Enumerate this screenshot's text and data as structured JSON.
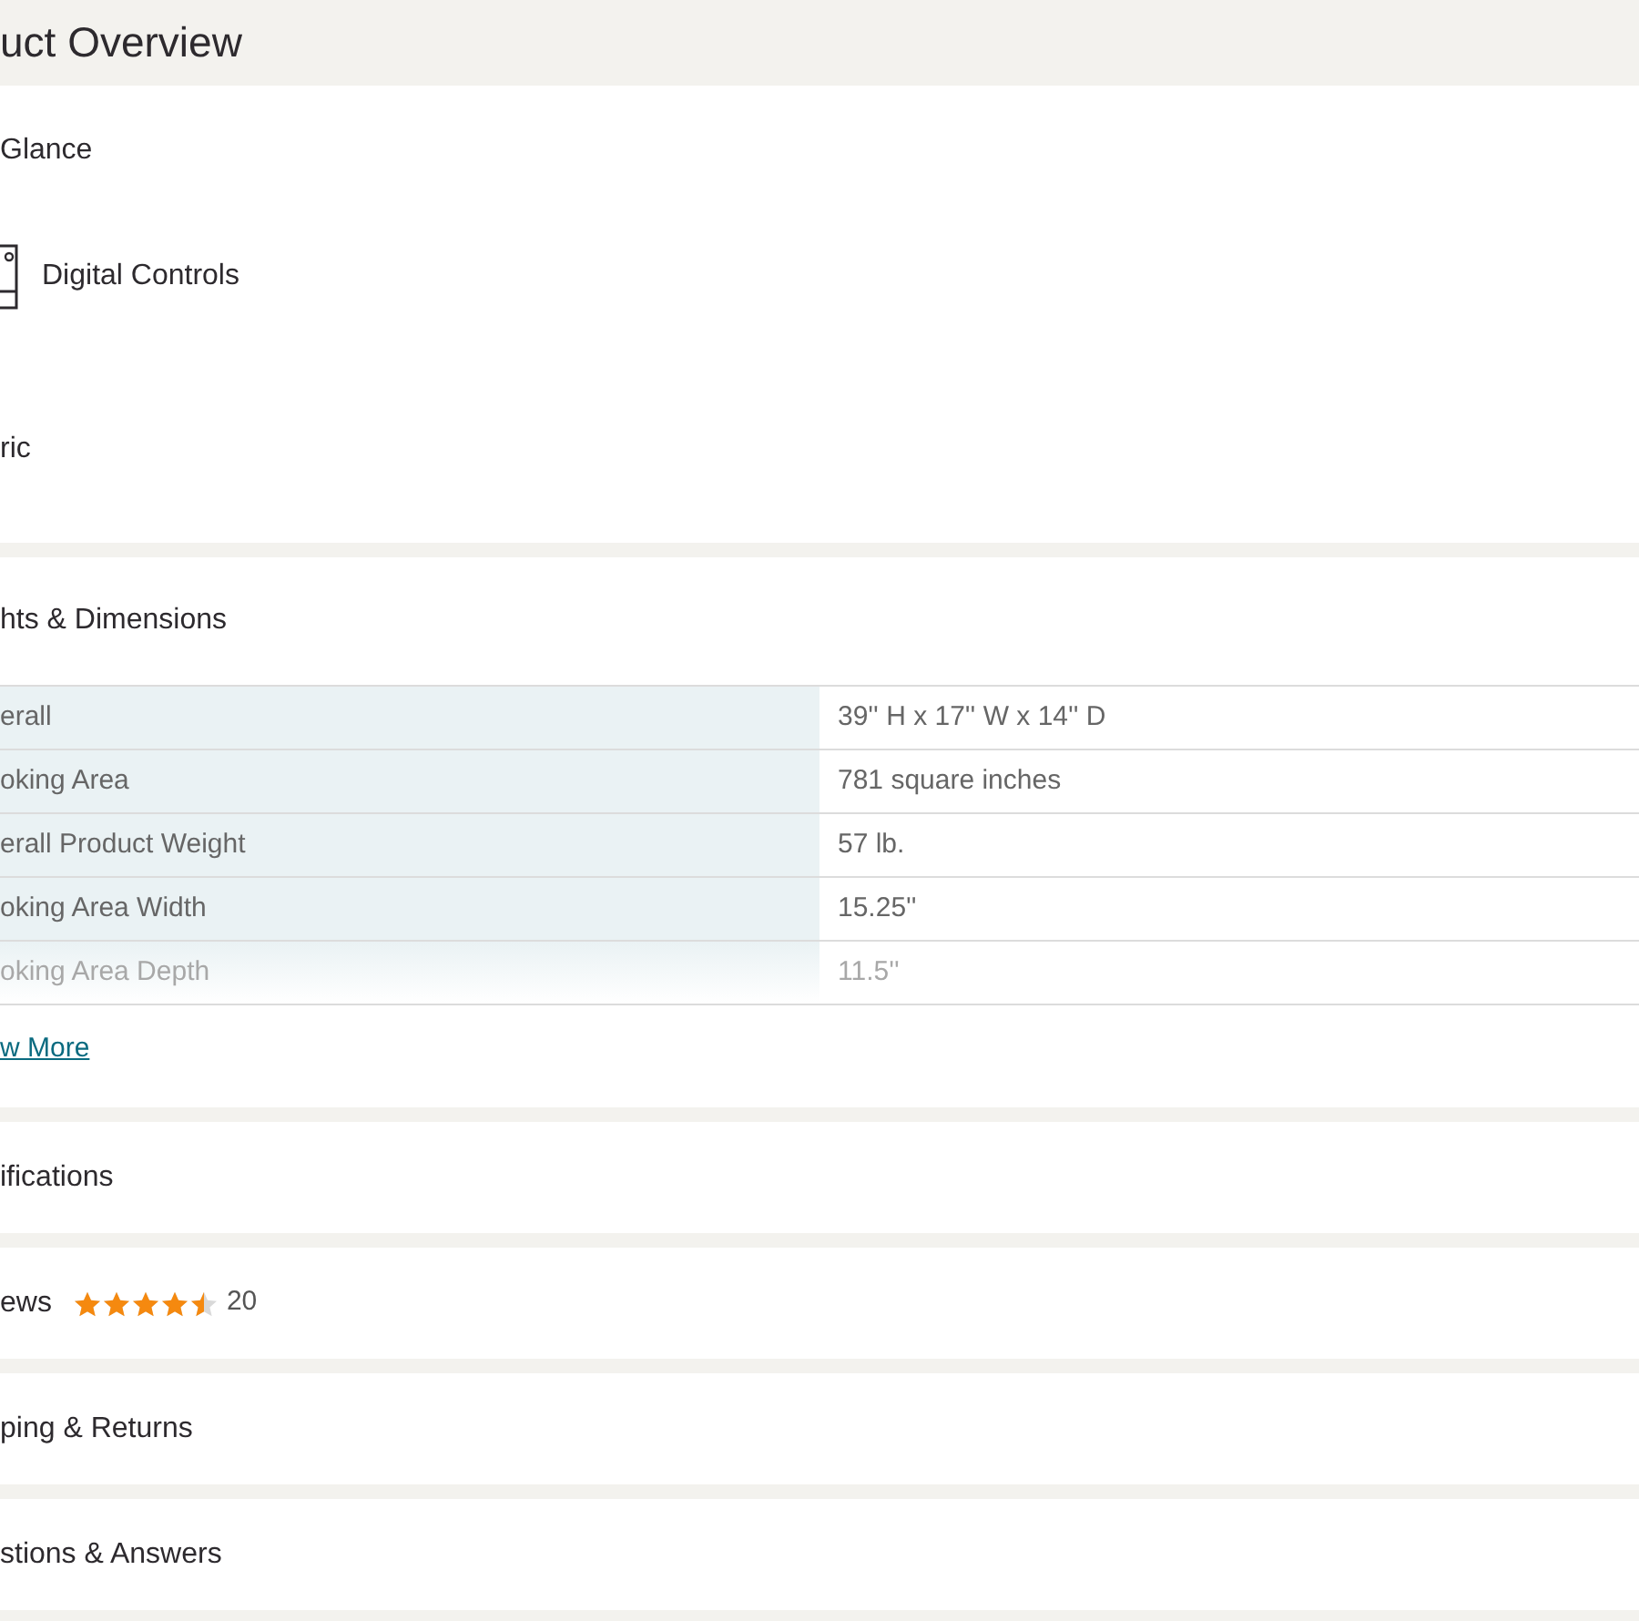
{
  "header": {
    "title": "uct Overview"
  },
  "at_a_glance": {
    "title": "Glance",
    "feature": "Digital Controls",
    "item": "ric"
  },
  "dimensions": {
    "title": "hts & Dimensions",
    "rows": [
      {
        "label": "erall",
        "value": "39'' H x 17'' W x 14'' D",
        "faded": false
      },
      {
        "label": "oking Area",
        "value": "781 square inches",
        "faded": false
      },
      {
        "label": "erall Product Weight",
        "value": "57 lb.",
        "faded": false
      },
      {
        "label": "oking Area Width",
        "value": "15.25''",
        "faded": false
      },
      {
        "label": "oking Area Depth",
        "value": "11.5''",
        "faded": true
      }
    ],
    "link": "w More"
  },
  "sections": [
    {
      "title": "ifications",
      "kind": "plain"
    },
    {
      "title": "ews",
      "kind": "reviews",
      "stars": 4.5,
      "count": "20"
    },
    {
      "title": "ping & Returns",
      "kind": "plain"
    },
    {
      "title": "stions & Answers",
      "kind": "plain"
    }
  ]
}
